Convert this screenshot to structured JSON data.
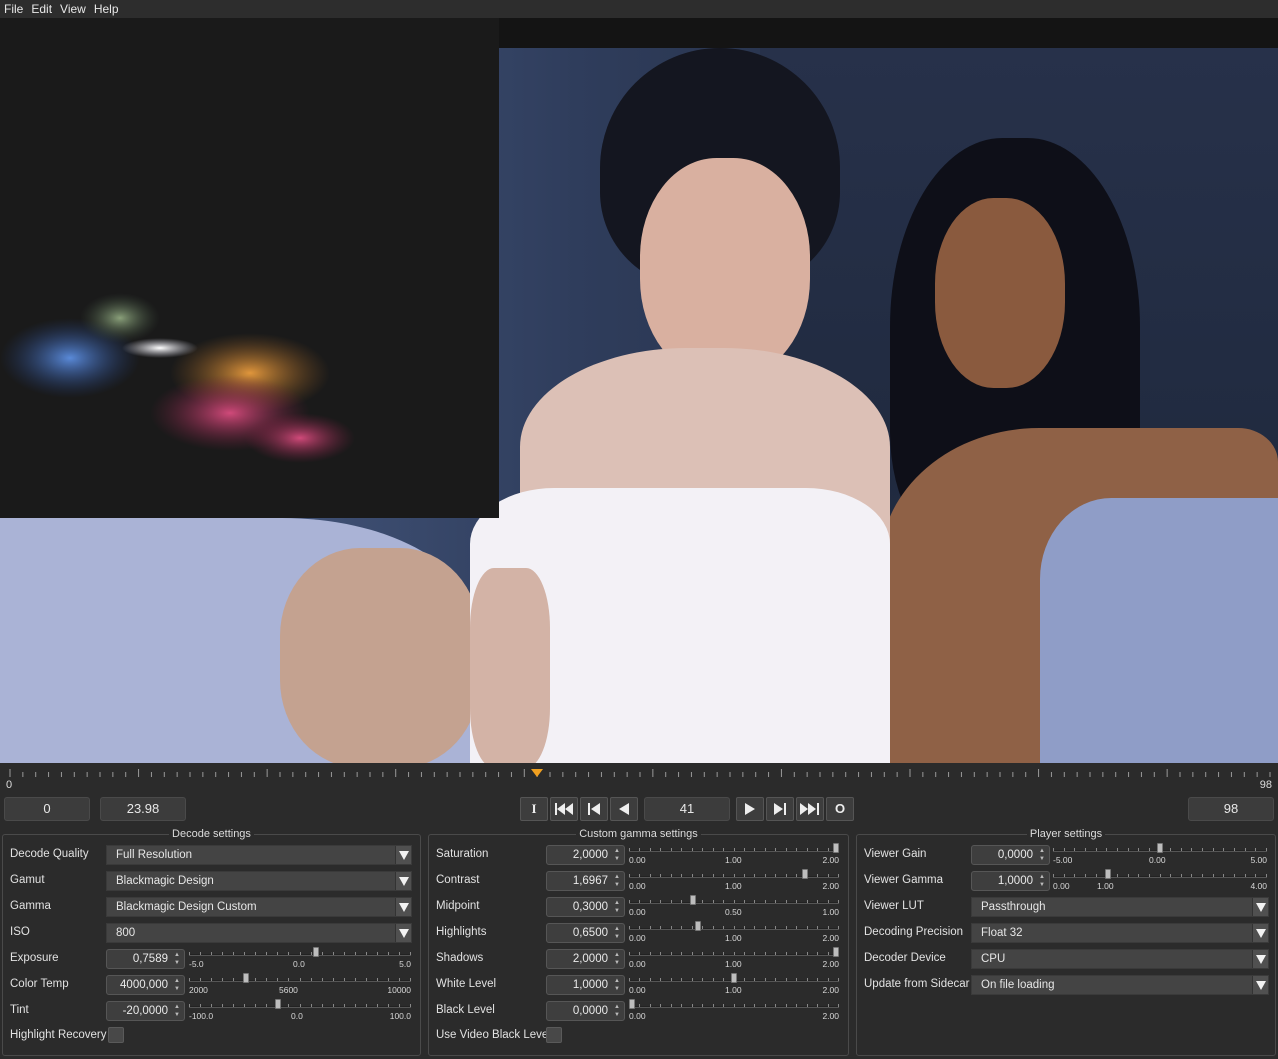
{
  "menu": [
    "File",
    "Edit",
    "View",
    "Help"
  ],
  "timeline": {
    "start": "0",
    "end": "98",
    "playhead_fraction": 0.42
  },
  "transport": {
    "start_frame": "0",
    "fps": "23.98",
    "in_button": "I",
    "out_button": "O",
    "current_frame": "41",
    "end_frame": "98"
  },
  "decode": {
    "title": "Decode settings",
    "decode_quality": {
      "label": "Decode Quality",
      "value": "Full Resolution"
    },
    "gamut": {
      "label": "Gamut",
      "value": "Blackmagic Design"
    },
    "gamma": {
      "label": "Gamma",
      "value": "Blackmagic Design Custom"
    },
    "iso": {
      "label": "ISO",
      "value": "800"
    },
    "exposure": {
      "label": "Exposure",
      "value": "0,7589",
      "min": "-5.0",
      "mid": "0.0",
      "max": "5.0",
      "fraction": 0.576
    },
    "color_temp": {
      "label": "Color Temp",
      "value": "4000,000",
      "min": "2000",
      "mid": "5600",
      "max": "10000",
      "fraction": 0.25
    },
    "tint": {
      "label": "Tint",
      "value": "-20,0000",
      "min": "-100.0",
      "mid": "0.0",
      "max": "100.0",
      "fraction": 0.4
    },
    "highlight_recovery": {
      "label": "Highlight Recovery"
    }
  },
  "gamma": {
    "title": "Custom gamma settings",
    "saturation": {
      "label": "Saturation",
      "value": "2,0000",
      "min": "0.00",
      "mid": "1.00",
      "max": "2.00",
      "fraction": 1.0
    },
    "contrast": {
      "label": "Contrast",
      "value": "1,6967",
      "min": "0.00",
      "mid": "1.00",
      "max": "2.00",
      "fraction": 0.848
    },
    "midpoint": {
      "label": "Midpoint",
      "value": "0,3000",
      "min": "0.00",
      "mid": "0.50",
      "max": "1.00",
      "fraction": 0.3
    },
    "highlights": {
      "label": "Highlights",
      "value": "0,6500",
      "min": "0.00",
      "mid": "1.00",
      "max": "2.00",
      "fraction": 0.325
    },
    "shadows": {
      "label": "Shadows",
      "value": "2,0000",
      "min": "0.00",
      "mid": "1.00",
      "max": "2.00",
      "fraction": 1.0
    },
    "white_level": {
      "label": "White Level",
      "value": "1,0000",
      "min": "0.00",
      "mid": "1.00",
      "max": "2.00",
      "fraction": 0.5
    },
    "black_level": {
      "label": "Black Level",
      "value": "0,0000",
      "min": "0.00",
      "mid": "",
      "max": "2.00",
      "fraction": 0.0
    },
    "use_video_black_level": {
      "label": "Use Video Black Level"
    }
  },
  "player": {
    "title": "Player settings",
    "viewer_gain": {
      "label": "Viewer Gain",
      "value": "0,0000",
      "min": "-5.00",
      "mid": "0.00",
      "max": "5.00",
      "fraction": 0.5
    },
    "viewer_gamma": {
      "label": "Viewer Gamma",
      "value": "1,0000",
      "min": "0.00",
      "mid": "1.00",
      "max": "4.00",
      "fraction": 0.25
    },
    "viewer_lut": {
      "label": "Viewer LUT",
      "value": "Passthrough"
    },
    "decoding_precision": {
      "label": "Decoding Precision",
      "value": "Float 32"
    },
    "decoder_device": {
      "label": "Decoder Device",
      "value": "CPU"
    },
    "update_from_sidecar": {
      "label": "Update from Sidecar",
      "value": "On file loading"
    }
  }
}
